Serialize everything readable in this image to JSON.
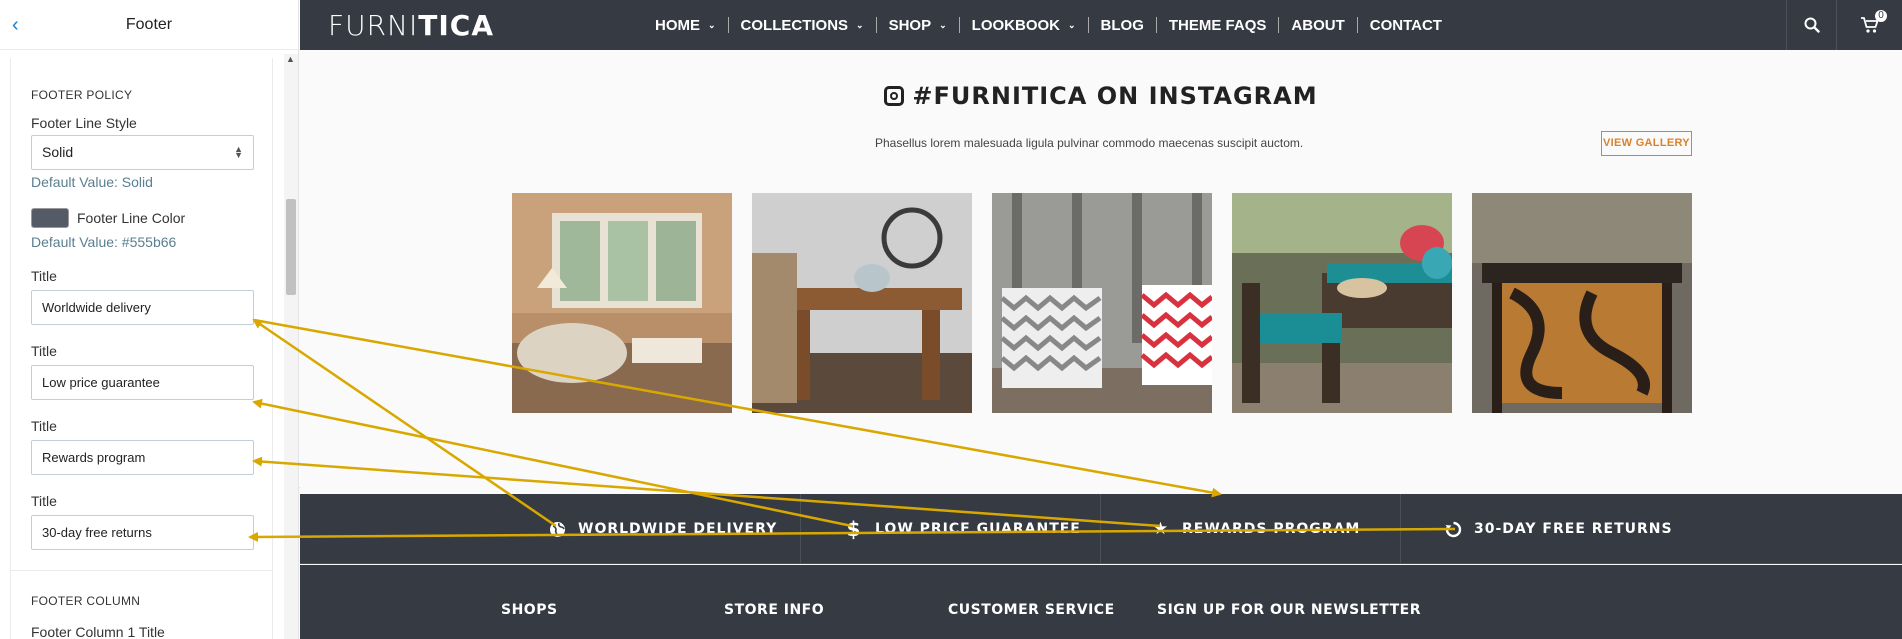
{
  "panel": {
    "title": "Footer",
    "footer_policy": {
      "section_label": "FOOTER POLICY",
      "line_style_label": "Footer Line Style",
      "line_style_value": "Solid",
      "line_style_default": "Default Value: Solid",
      "line_color_label": "Footer Line Color",
      "line_color_value": "#555b66",
      "line_color_default": "Default Value: #555b66",
      "titles": [
        {
          "label": "Title",
          "value": "Worldwide delivery"
        },
        {
          "label": "Title",
          "value": "Low price guarantee"
        },
        {
          "label": "Title",
          "value": "Rewards program"
        },
        {
          "label": "Title",
          "value": "30-day free returns"
        }
      ]
    },
    "footer_column": {
      "section_label": "FOOTER COLUMN",
      "column1_title_label": "Footer Column 1 Title"
    }
  },
  "store": {
    "logo_prefix": "FURNI",
    "logo_suffix": "TICA",
    "nav": [
      {
        "label": "HOME",
        "has_dropdown": true
      },
      {
        "label": "COLLECTIONS",
        "has_dropdown": true
      },
      {
        "label": "SHOP",
        "has_dropdown": true
      },
      {
        "label": "LOOKBOOK",
        "has_dropdown": true
      },
      {
        "label": "BLOG",
        "has_dropdown": false
      },
      {
        "label": "THEME FAQS",
        "has_dropdown": false
      },
      {
        "label": "ABOUT",
        "has_dropdown": false
      },
      {
        "label": "CONTACT",
        "has_dropdown": false
      }
    ],
    "cart_count": "0",
    "instagram": {
      "title": "#FURNITICA ON INSTAGRAM",
      "subtitle": "Phasellus lorem malesuada ligula pulvinar commodo maecenas suscipit auctom.",
      "view_gallery": "VIEW GALLERY",
      "photos": [
        "living-room-photo",
        "dining-table-photo",
        "chevron-pillows-photo",
        "patio-furniture-photo",
        "wood-table-photo"
      ]
    },
    "features": [
      {
        "icon": "globe-icon",
        "label": "WORLDWIDE DELIVERY"
      },
      {
        "icon": "dollar-icon",
        "label": "LOW PRICE GUARANTEE"
      },
      {
        "icon": "star-icon",
        "label": "REWARDS PROGRAM"
      },
      {
        "icon": "return-icon",
        "label": "30-DAY FREE RETURNS"
      }
    ],
    "footer_columns": [
      "SHOPS",
      "STORE INFO",
      "CUSTOMER SERVICE",
      "SIGN UP FOR OUR NEWSLETTER"
    ]
  },
  "colors": {
    "dark_bar": "#353a43",
    "accent_orange": "#d9822b",
    "annotation_arrow": "#d9a800",
    "link_blue": "#1b7fc4"
  }
}
